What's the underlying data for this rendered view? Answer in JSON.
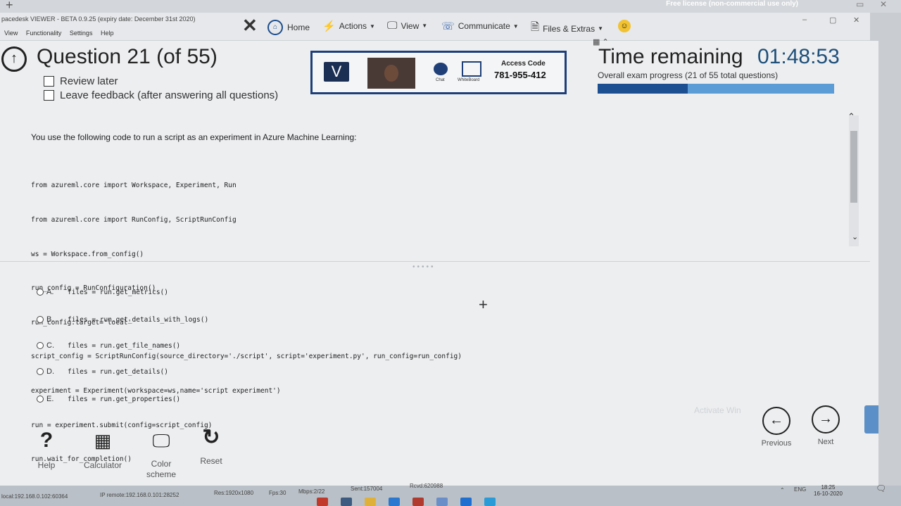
{
  "window": {
    "license_text": "Free license (non-commercial use only)"
  },
  "viewer": {
    "title": "pacedesk VIEWER - BETA 0.9.25 (expiry date: December 31st 2020)",
    "menu": [
      "View",
      "Functionality",
      "Settings",
      "Help"
    ],
    "toolbar": {
      "home": "Home",
      "actions": "Actions",
      "view": "View",
      "communicate": "Communicate",
      "files": "Files & Extras"
    }
  },
  "question": {
    "title": "Question 21 (of 55)",
    "review_later": "Review later",
    "leave_feedback": "Leave feedback (after answering all questions)",
    "prompt": "You use the following code to run a script as an experiment in Azure Machine Learning:",
    "code_lines": [
      "from azureml.core import Workspace, Experiment, Run",
      "from azureml.core import RunConfig, ScriptRunConfig",
      "ws = Workspace.from_config()",
      "run_config = RunConfiguration()",
      "run_config.target='local'",
      "script_config = ScriptRunConfig(source_directory='./script', script='experiment.py', run_config=run_config)",
      "experiment = Experiment(workspace=ws,name='script experiment')",
      "run = experiment.submit(config=script_config)",
      "run.wait_for_completion()"
    ]
  },
  "spacedesk": {
    "chat_label": "Chat",
    "whiteboard_label": "WhiteBoard",
    "access_code_label": "Access Code",
    "access_code": "781-955-412"
  },
  "timer": {
    "label": "Time remaining",
    "value": "01:48:53",
    "progress_label": "Overall exam progress (21 of 55 total questions)",
    "progress_fraction": 0.38
  },
  "answers": [
    {
      "letter": "A.",
      "code": "files = run.get_metrics()"
    },
    {
      "letter": "B.",
      "code": "files = run.get_details_with_logs()"
    },
    {
      "letter": "C.",
      "code": "files = run.get_file_names()"
    },
    {
      "letter": "D.",
      "code": "files = run.get_details()"
    },
    {
      "letter": "E.",
      "code": "files = run.get_properties()"
    }
  ],
  "tools": {
    "help": "Help",
    "calculator": "Calculator",
    "color_scheme_line1": "Color",
    "color_scheme_line2": "scheme",
    "reset": "Reset"
  },
  "nav": {
    "previous": "Previous",
    "next": "Next"
  },
  "watermark": "Activate Win",
  "status": {
    "local": "local:192.168.0.102:60364",
    "remote": "IP remote:192.168.0.101:28252",
    "res": "Res:1920x1080",
    "fps": "Fps:30",
    "mbps": "Mbps:2/22",
    "sent": "Sent:157004",
    "rcvd": "Rcvd:620988",
    "lang": "ENG",
    "time": "18:25",
    "date": "16-10-2020"
  },
  "colors": {
    "progress_fill": "#1c4f92",
    "progress_track": "#5b9bd6",
    "timer_value": "#1e4f7a"
  }
}
